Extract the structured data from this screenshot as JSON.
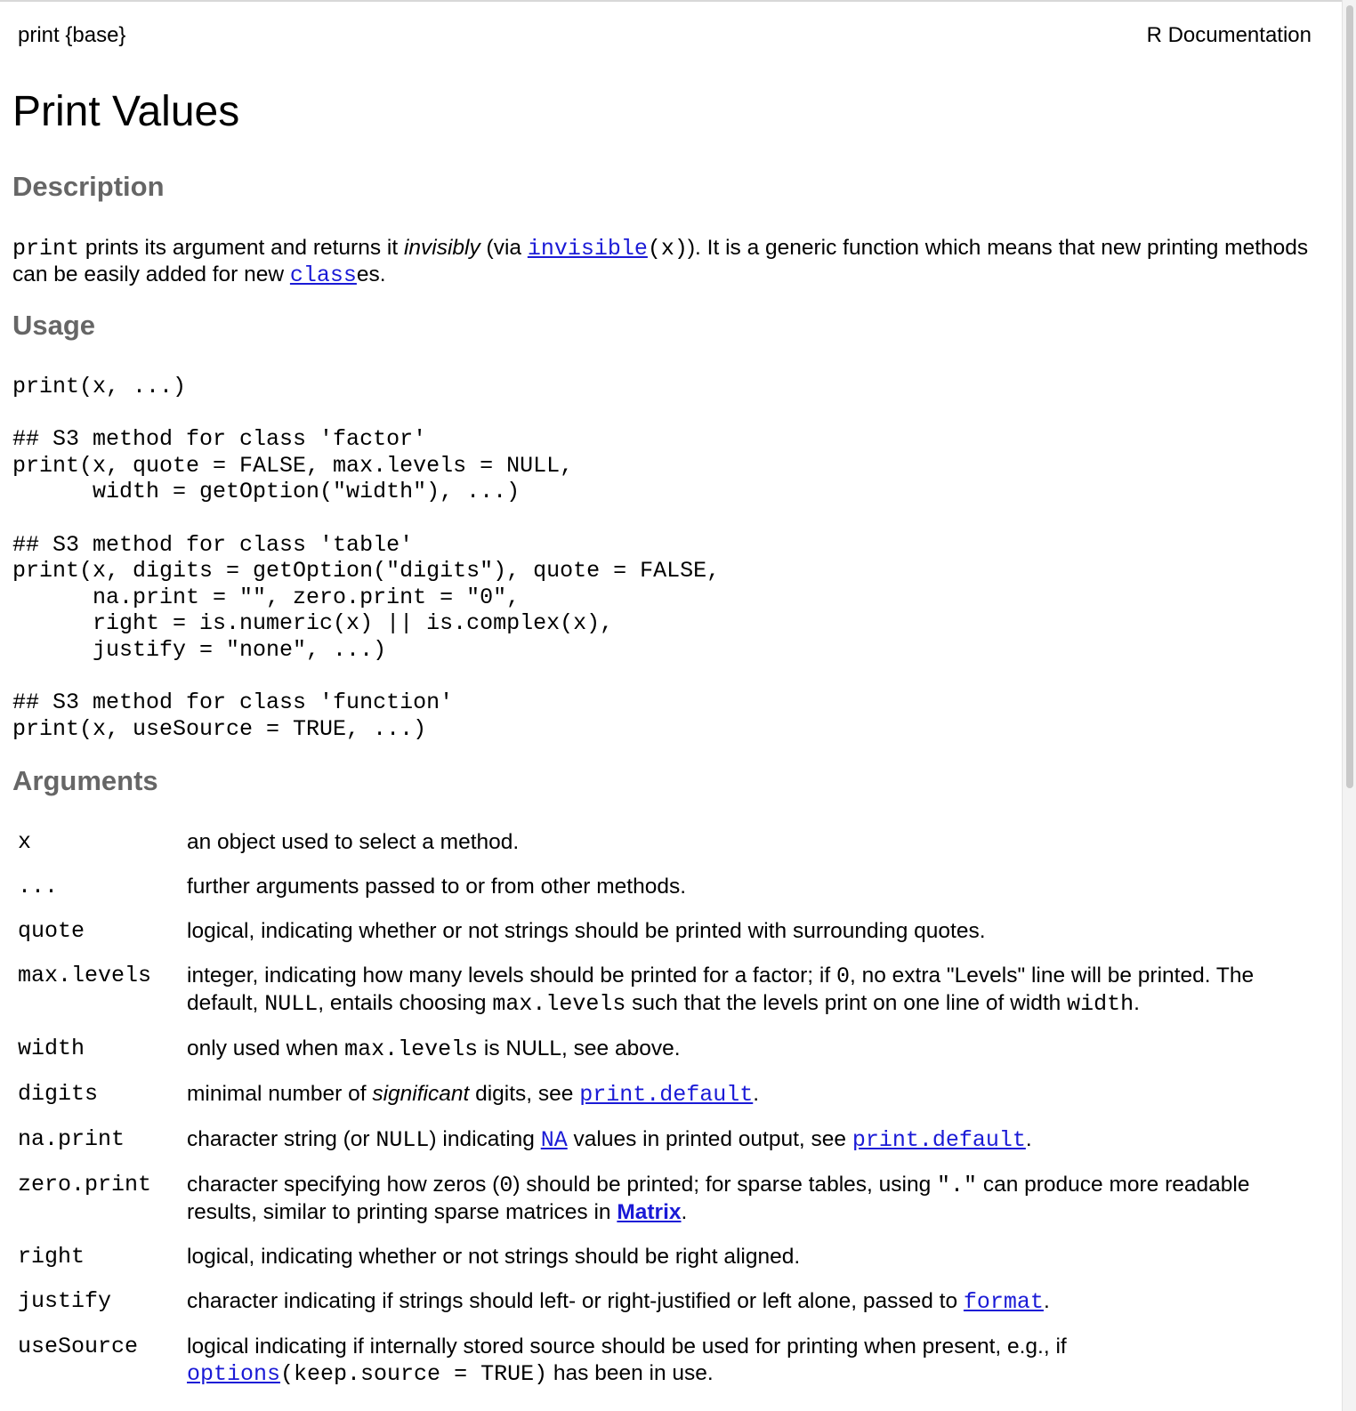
{
  "header": {
    "left": "print {base}",
    "right": "R Documentation"
  },
  "title": "Print Values",
  "description": {
    "heading": "Description",
    "code_print": "print",
    "text1": " prints its argument and returns it ",
    "italic_invisibly": "invisibly",
    "text2": " (via ",
    "link_invisible": "invisible",
    "code_x": "(x)",
    "text3": "). It is a generic function which means that new printing methods can be easily added for new ",
    "link_class": "class",
    "text4": "es."
  },
  "usage": {
    "heading": "Usage",
    "code": "print(x, ...)\n\n## S3 method for class 'factor'\nprint(x, quote = FALSE, max.levels = NULL,\n      width = getOption(\"width\"), ...)\n\n## S3 method for class 'table'\nprint(x, digits = getOption(\"digits\"), quote = FALSE,\n      na.print = \"\", zero.print = \"0\",\n      right = is.numeric(x) || is.complex(x),\n      justify = \"none\", ...)\n\n## S3 method for class 'function'\nprint(x, useSource = TRUE, ...)"
  },
  "arguments": {
    "heading": "Arguments",
    "x": {
      "name": "x",
      "desc": "an object used to select a method."
    },
    "dots": {
      "name": "...",
      "desc": "further arguments passed to or from other methods."
    },
    "quote": {
      "name": "quote",
      "desc": "logical, indicating whether or not strings should be printed with surrounding quotes."
    },
    "max_levels": {
      "name": "max.levels",
      "t1": "integer, indicating how many levels should be printed for a factor; if ",
      "c1": "0",
      "t2": ", no extra \"Levels\" line will be printed. The default, ",
      "c2": "NULL",
      "t3": ", entails choosing ",
      "c3": "max.levels",
      "t4": " such that the levels print on one line of width ",
      "c4": "width",
      "t5": "."
    },
    "width": {
      "name": "width",
      "t1": "only used when ",
      "c1": "max.levels",
      "t2": " is NULL, see above."
    },
    "digits": {
      "name": "digits",
      "t1": "minimal number of ",
      "i1": "significant",
      "t2": " digits, see ",
      "link1": "print.default",
      "t3": "."
    },
    "na_print": {
      "name": "na.print",
      "t1": "character string (or ",
      "c1": "NULL",
      "t2": ") indicating ",
      "link1": "NA",
      "t3": " values in printed output, see ",
      "link2": "print.default",
      "t4": "."
    },
    "zero_print": {
      "name": "zero.print",
      "t1": "character specifying how zeros (",
      "c1": "0",
      "t2": ") should be printed; for sparse tables, using ",
      "c2": "\".\"",
      "t3": " can produce more readable results, similar to printing sparse matrices in ",
      "link1": "Matrix",
      "t4": "."
    },
    "right": {
      "name": "right",
      "desc": "logical, indicating whether or not strings should be right aligned."
    },
    "justify": {
      "name": "justify",
      "t1": "character indicating if strings should left- or right-justified or left alone, passed to ",
      "link1": "format",
      "t2": "."
    },
    "use_source": {
      "name": "useSource",
      "t1": "logical indicating if internally stored source should be used for printing when present, e.g., if ",
      "link1": "options",
      "c1": "(keep.source = TRUE)",
      "t2": " has been in use."
    }
  }
}
